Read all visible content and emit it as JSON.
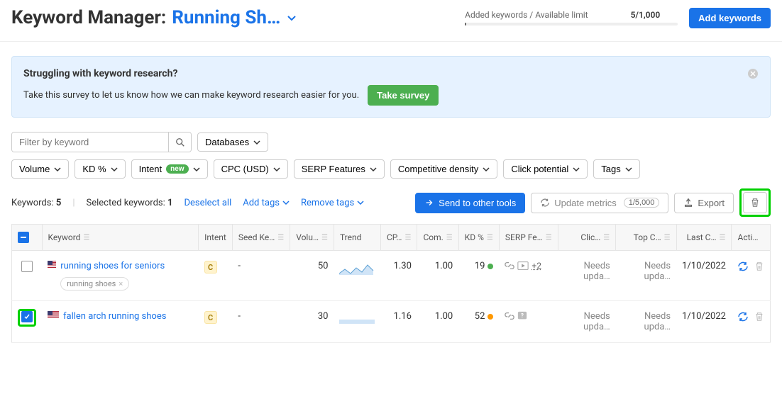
{
  "header": {
    "title_prefix": "Keyword Manager:",
    "project_name": "Running Sh…",
    "limit_label": "Added keywords / Available limit",
    "limit_value": "5/1,000",
    "add_button": "Add keywords"
  },
  "banner": {
    "title": "Struggling with keyword research?",
    "text": "Take this survey to let us know how we can make keyword research easier for you.",
    "cta": "Take survey"
  },
  "filters": {
    "search_placeholder": "Filter by keyword",
    "databases": "Databases",
    "volume": "Volume",
    "kd": "KD %",
    "intent": "Intent",
    "intent_badge": "new",
    "cpc": "CPC (USD)",
    "serp": "SERP Features",
    "competitive": "Competitive density",
    "click_potential": "Click potential",
    "tags": "Tags"
  },
  "toolbar": {
    "keywords_label": "Keywords:",
    "keywords_count": "5",
    "selected_label": "Selected keywords:",
    "selected_count": "1",
    "deselect": "Deselect all",
    "add_tags": "Add tags",
    "remove_tags": "Remove tags",
    "send": "Send to other tools",
    "update": "Update metrics",
    "update_limit": "1/5,000",
    "export": "Export"
  },
  "columns": {
    "keyword": "Keyword",
    "intent": "Intent",
    "seed": "Seed Ke…",
    "volume": "Volu…",
    "trend": "Trend",
    "cpc": "CP…",
    "com": "Com.",
    "kd": "KD %",
    "serp": "SERP Fe…",
    "click": "Clic…",
    "top": "Top C…",
    "last": "Last C…",
    "actions": "Acti…"
  },
  "rows": [
    {
      "checked": false,
      "keyword": "running shoes for seniors",
      "intent": "C",
      "seed": "-",
      "volume": "50",
      "trend_type": "line",
      "cpc": "1.30",
      "com": "1.00",
      "kd": "19",
      "kd_color": "green",
      "serp_more": "+2",
      "serp_icons": [
        "link",
        "video"
      ],
      "click": "Needs upda…",
      "top": "Needs upda…",
      "last": "1/10/2022",
      "tag": "running shoes"
    },
    {
      "checked": true,
      "keyword": "fallen arch running shoes",
      "intent": "C",
      "seed": "-",
      "volume": "30",
      "trend_type": "flat",
      "cpc": "1.16",
      "com": "1.00",
      "kd": "52",
      "kd_color": "orange",
      "serp_more": "",
      "serp_icons": [
        "link",
        "question"
      ],
      "click": "Needs upda…",
      "top": "Needs upda…",
      "last": "1/10/2022",
      "tag": ""
    }
  ]
}
